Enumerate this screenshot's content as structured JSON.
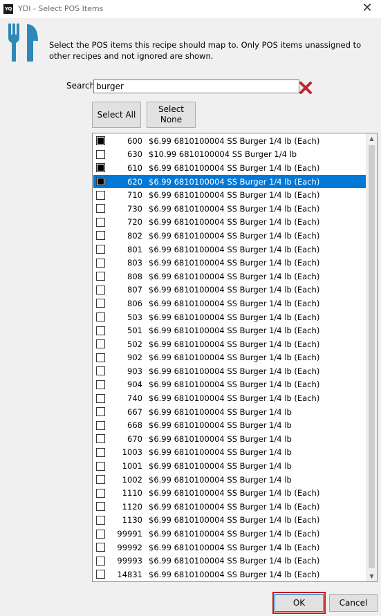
{
  "window": {
    "app_icon_text": "YQ",
    "title": "YDI - Select POS Items",
    "close_glyph": "✕"
  },
  "header": {
    "icon": "fork-knife-icon",
    "instructions": "Select the POS items this recipe should map to. Only POS items unassigned to other recipes and not ignored are shown."
  },
  "search": {
    "label": "Search",
    "value": "burger",
    "clear_icon": "red-x-icon"
  },
  "buttons": {
    "select_all": "Select All",
    "select_none": "Select\nNone",
    "ok": "OK",
    "cancel": "Cancel"
  },
  "list": {
    "selected_index": 3,
    "items": [
      {
        "code": "600",
        "text": "$6.99 6810100004 SS Burger 1/4 lb (Each)",
        "checked": true
      },
      {
        "code": "630",
        "text": "$10.99 6810100004 SS Burger 1/4 lb",
        "checked": false
      },
      {
        "code": "610",
        "text": "$6.99 6810100004 SS Burger 1/4 lb (Each)",
        "checked": true
      },
      {
        "code": "620",
        "text": "$6.99 6810100004 SS Burger 1/4 lb (Each)",
        "checked": true
      },
      {
        "code": "710",
        "text": "$6.99 6810100004 SS Burger 1/4 lb (Each)",
        "checked": false
      },
      {
        "code": "730",
        "text": "$6.99 6810100004 SS Burger 1/4 lb (Each)",
        "checked": false
      },
      {
        "code": "720",
        "text": "$6.99 6810100004 SS Burger 1/4 lb (Each)",
        "checked": false
      },
      {
        "code": "802",
        "text": "$6.99 6810100004 SS Burger 1/4 lb (Each)",
        "checked": false
      },
      {
        "code": "801",
        "text": "$6.99 6810100004 SS Burger 1/4 lb (Each)",
        "checked": false
      },
      {
        "code": "803",
        "text": "$6.99 6810100004 SS Burger 1/4 lb (Each)",
        "checked": false
      },
      {
        "code": "808",
        "text": "$6.99 6810100004 SS Burger 1/4 lb (Each)",
        "checked": false
      },
      {
        "code": "807",
        "text": "$6.99 6810100004 SS Burger 1/4 lb (Each)",
        "checked": false
      },
      {
        "code": "806",
        "text": "$6.99 6810100004 SS Burger 1/4 lb (Each)",
        "checked": false
      },
      {
        "code": "503",
        "text": "$6.99 6810100004 SS Burger 1/4 lb (Each)",
        "checked": false
      },
      {
        "code": "501",
        "text": "$6.99 6810100004 SS Burger 1/4 lb (Each)",
        "checked": false
      },
      {
        "code": "502",
        "text": "$6.99 6810100004 SS Burger 1/4 lb (Each)",
        "checked": false
      },
      {
        "code": "902",
        "text": "$6.99 6810100004 SS Burger 1/4 lb (Each)",
        "checked": false
      },
      {
        "code": "903",
        "text": "$6.99 6810100004 SS Burger 1/4 lb (Each)",
        "checked": false
      },
      {
        "code": "904",
        "text": "$6.99 6810100004 SS Burger 1/4 lb (Each)",
        "checked": false
      },
      {
        "code": "740",
        "text": "$6.99 6810100004 SS Burger 1/4 lb (Each)",
        "checked": false
      },
      {
        "code": "667",
        "text": "$6.99 6810100004 SS Burger 1/4 lb",
        "checked": false
      },
      {
        "code": "668",
        "text": "$6.99 6810100004 SS Burger 1/4 lb",
        "checked": false
      },
      {
        "code": "670",
        "text": "$6.99 6810100004 SS Burger 1/4 lb",
        "checked": false
      },
      {
        "code": "1003",
        "text": "$6.99 6810100004 SS Burger 1/4 lb",
        "checked": false
      },
      {
        "code": "1001",
        "text": "$6.99 6810100004 SS Burger 1/4 lb",
        "checked": false
      },
      {
        "code": "1002",
        "text": "$6.99 6810100004 SS Burger 1/4 lb",
        "checked": false
      },
      {
        "code": "1110",
        "text": "$6.99 6810100004 SS Burger 1/4 lb (Each)",
        "checked": false
      },
      {
        "code": "1120",
        "text": "$6.99 6810100004 SS Burger 1/4 lb (Each)",
        "checked": false
      },
      {
        "code": "1130",
        "text": "$6.99 6810100004 SS Burger 1/4 lb (Each)",
        "checked": false
      },
      {
        "code": "99991",
        "text": "$6.99 6810100004 SS Burger 1/4 lb (Each)",
        "checked": false
      },
      {
        "code": "99992",
        "text": "$6.99 6810100004 SS Burger 1/4 lb (Each)",
        "checked": false
      },
      {
        "code": "99993",
        "text": "$6.99 6810100004 SS Burger 1/4 lb (Each)",
        "checked": false
      },
      {
        "code": "14831",
        "text": "$6.99 6810100004 SS Burger 1/4 lb (Each)",
        "checked": false
      }
    ]
  },
  "colors": {
    "selection": "#0078d7",
    "clear_icon": "#c0262e",
    "header_icon": "#2e88b8",
    "ok_highlight": "#c9191e"
  }
}
